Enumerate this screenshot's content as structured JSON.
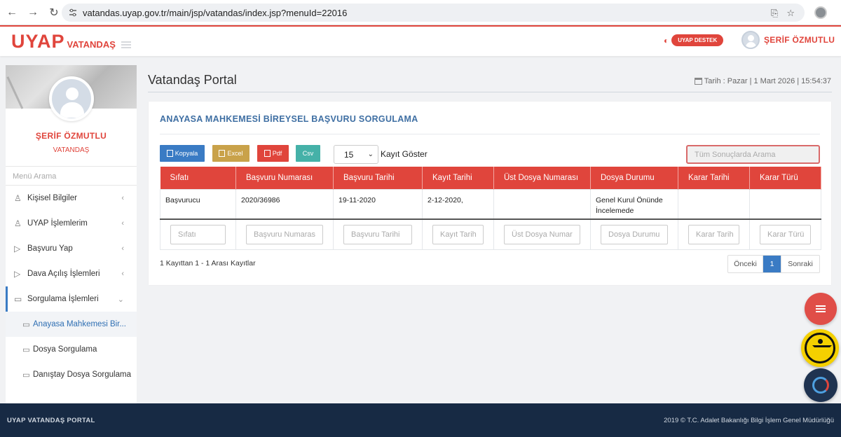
{
  "browser": {
    "url": "vatandas.uyap.gov.tr/main/jsp/vatandas/index.jsp?menuId=22016"
  },
  "header": {
    "logo_main": "UYAP",
    "logo_sub": "VATANDAŞ",
    "support_label": "UYAP DESTEK",
    "user_name": "ŞERİF ÖZMUTLU"
  },
  "sidebar": {
    "profile_name": "ŞERİF ÖZMUTLU",
    "profile_role": "VATANDAŞ",
    "menu_search_placeholder": "Menü Arama",
    "items": [
      {
        "label": "Kişisel Bilgiler",
        "icon": "user-icon"
      },
      {
        "label": "UYAP İşlemlerim",
        "icon": "user-icon"
      },
      {
        "label": "Başvuru Yap",
        "icon": "play-icon"
      },
      {
        "label": "Dava Açılış İşlemleri",
        "icon": "play-icon"
      },
      {
        "label": "Sorgulama İşlemleri",
        "icon": "folder-icon"
      }
    ],
    "subitems": [
      {
        "label": "Anayasa Mahkemesi Bir..."
      },
      {
        "label": "Dosya Sorgulama"
      },
      {
        "label": "Danıştay Dosya Sorgulama"
      }
    ]
  },
  "main": {
    "page_title": "Vatandaş Portal",
    "datetime": "Tarih : Pazar | 1 Mart 2026 | 15:54:37",
    "card_title": "ANAYASA MAHKEMESİ BİREYSEL BAŞVURU SORGULAMA",
    "buttons": {
      "copy": "Kopyala",
      "excel": "Excel",
      "pdf": "Pdf",
      "csv": "Csv"
    },
    "page_size": "15",
    "page_size_label": "Kayıt Göster",
    "search_placeholder": "Tüm Sonuçlarda Arama",
    "columns": [
      "Sıfatı",
      "Başvuru Numarası",
      "Başvuru Tarihi",
      "Kayıt Tarihi",
      "Üst Dosya Numarası",
      "Dosya Durumu",
      "Karar Tarihi",
      "Karar Türü"
    ],
    "rows": [
      [
        "Başvurucu",
        "2020/36986",
        "19-11-2020",
        "2-12-2020,",
        "",
        "Genel Kurul Önünde İncelemede",
        "",
        ""
      ]
    ],
    "filters": [
      "Sıfatı",
      "Başvuru Numaras",
      "Başvuru Tarihi",
      "Kayıt Tarih",
      "Üst Dosya Numar",
      "Dosya Durumu",
      "Karar Tarih",
      "Karar Türü"
    ],
    "info": "1 Kayıttan 1 - 1 Arası Kayıtlar",
    "pager": {
      "prev": "Önceki",
      "current": "1",
      "next": "Sonraki"
    }
  },
  "footer": {
    "left": "UYAP VATANDAŞ PORTAL",
    "right": "2019 © T.C. Adalet Bakanlığı Bilgi İşlem Genel Müdürlüğü"
  },
  "colors": {
    "brand_red": "#e0453c",
    "accent_blue": "#3a7bc4",
    "footer_bg": "#172a44"
  }
}
